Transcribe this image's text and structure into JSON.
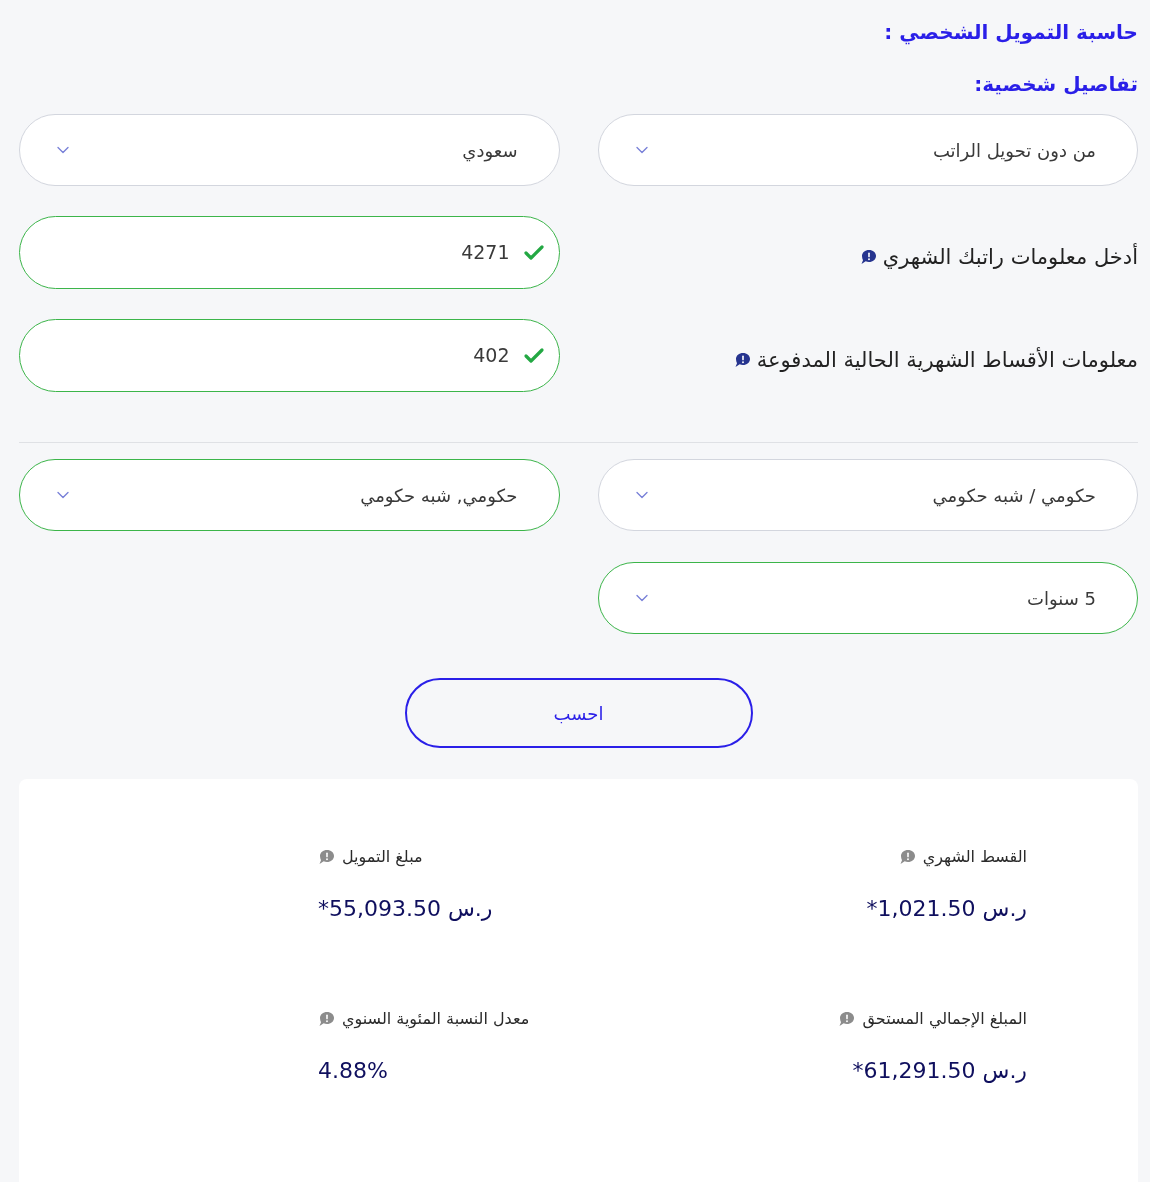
{
  "title": "حاسبة التمويل الشخصي :",
  "section_title": "تفاصيل شخصية:",
  "sections": [
    {
      "rows": [
        {
          "cells": [
            {
              "kind": "select",
              "value": "من دون تحويل الراتب",
              "valid": false
            },
            {
              "kind": "select",
              "value": "سعودي",
              "valid": false
            }
          ]
        },
        {
          "cells": [
            {
              "kind": "label",
              "text": "أدخل معلومات راتبك الشهري"
            },
            {
              "kind": "input",
              "value": "4271",
              "valid": true
            }
          ]
        },
        {
          "cells": [
            {
              "kind": "label",
              "text": "معلومات الأقساط الشهرية الحالية المدفوعة"
            },
            {
              "kind": "input",
              "value": "402",
              "valid": true
            }
          ]
        }
      ]
    },
    {
      "rows": [
        {
          "cells": [
            {
              "kind": "select",
              "value": "حكومي / شبه حكومي",
              "valid": false
            },
            {
              "kind": "select",
              "value": "حكومي, شبه حكومي",
              "valid": true
            }
          ]
        },
        {
          "cells": [
            {
              "kind": "select",
              "value": "5 سنوات",
              "valid": true
            }
          ]
        }
      ]
    }
  ],
  "calculate_button": {
    "label": "احسب"
  },
  "results": [
    {
      "label": "القسط الشهري",
      "value": "ر.س 1,021.50*"
    },
    {
      "label": "مبلغ التمويل",
      "value": "ر.س 55,093.50*"
    },
    {
      "label": "المبلغ الإجمالي المستحق",
      "value": "ر.س 61,291.50*"
    },
    {
      "label": "معدل النسبة المئوية السنوي",
      "value": "4.88%"
    }
  ]
}
